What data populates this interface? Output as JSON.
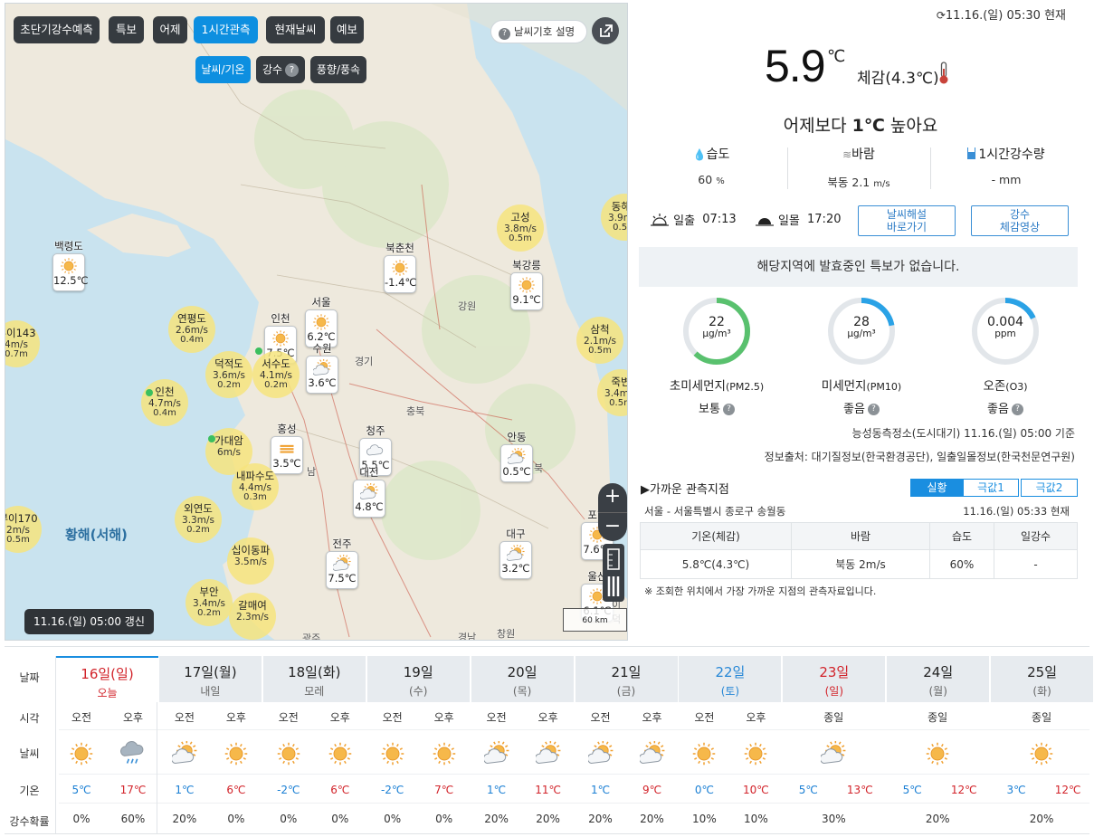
{
  "map": {
    "tabs": [
      "초단기강수예측",
      "특보",
      "어제",
      "1시간관측",
      "현재날씨",
      "예보"
    ],
    "active_tab": "1시간관측",
    "subtabs": [
      "날씨/기온",
      "강수",
      "풍향/풍속"
    ],
    "active_subtab": "날씨/기온",
    "subtab_help": "?",
    "legend_button": "날씨기호 설명",
    "legend_help": "?",
    "sea_label": "황해(서해)",
    "update_label": "11.16.(일) 05:00 갱신",
    "zoom_in": "+",
    "zoom_out": "−",
    "scale_label": "60 km",
    "temp_markers": [
      {
        "name": "백령도",
        "temp": "12.5℃",
        "icon": "sun-icon"
      },
      {
        "name": "북춘천",
        "temp": "-1.4℃",
        "icon": "sun-icon"
      },
      {
        "name": "북강릉",
        "temp": "9.1℃",
        "icon": "sun-icon"
      },
      {
        "name": "인천",
        "temp": "7.5℃",
        "icon": "sun-icon"
      },
      {
        "name": "서울",
        "temp": "6.2℃",
        "icon": "sun-icon"
      },
      {
        "name": "수원",
        "temp": "3.6℃",
        "icon": "cloud-sun-icon"
      },
      {
        "name": "홍성",
        "temp": "3.5℃",
        "icon": "haze-icon"
      },
      {
        "name": "청주",
        "temp": "5.5℃",
        "icon": "cloud-icon"
      },
      {
        "name": "대전",
        "temp": "4.8℃",
        "icon": "cloud-sun-icon"
      },
      {
        "name": "안동",
        "temp": "0.5℃",
        "icon": "cloud-sun-icon"
      },
      {
        "name": "대구",
        "temp": "3.2℃",
        "icon": "cloud-sun-icon"
      },
      {
        "name": "포항",
        "temp": "7.6℃",
        "icon": "sun-icon"
      },
      {
        "name": "전주",
        "temp": "7.5℃",
        "icon": "cloud-sun-icon"
      },
      {
        "name": "울산",
        "temp": "6.1℃",
        "icon": "sun-icon"
      }
    ],
    "wind_markers": [
      {
        "name": "고성",
        "wind": "3.8m/s",
        "wave": "0.5m"
      },
      {
        "name": "동해5",
        "wind": "3.9m/s",
        "wave": "0.5m"
      },
      {
        "name": "연평도",
        "wind": "2.6m/s",
        "wave": "0.4m"
      },
      {
        "name": "삼척",
        "wind": "2.1m/s",
        "wave": "0.5m"
      },
      {
        "name": "덕적도",
        "wind": "3.6m/s",
        "wave": "0.2m"
      },
      {
        "name": "서수도",
        "wind": "4.1m/s",
        "wave": "0.2m"
      },
      {
        "name": "죽변",
        "wind": "3.4m/s",
        "wave": "0.5m"
      },
      {
        "name": "인천",
        "wind": "4.7m/s",
        "wave": "0.4m"
      },
      {
        "name": "부이143",
        "wind": "4m/s",
        "wave": "0.7m"
      },
      {
        "name": "가대암",
        "wind": "6m/s",
        "wave": ""
      },
      {
        "name": "내파수도",
        "wind": "4.4m/s",
        "wave": "0.3m"
      },
      {
        "name": "외연도",
        "wind": "3.3m/s",
        "wave": "0.2m"
      },
      {
        "name": "부이170",
        "wind": "2m/s",
        "wave": "0.5m"
      },
      {
        "name": "십이동파",
        "wind": "3.5m/s",
        "wave": ""
      },
      {
        "name": "부안",
        "wind": "3.4m/s",
        "wave": "0.2m"
      },
      {
        "name": "갈매여",
        "wind": "2.3m/s",
        "wave": ""
      }
    ],
    "cities": [
      "강원",
      "경기",
      "충북",
      "북",
      "남",
      "경북",
      "경남",
      "창원",
      "광주",
      "이덕"
    ]
  },
  "current": {
    "timestamp": "11.16.(일) 05:30 현재",
    "temp_value": "5.9",
    "temp_unit": "℃",
    "feels_like": "체감(4.3℃)",
    "comparison_prefix": "어제보다 ",
    "comparison_value": "1℃",
    "comparison_suffix": " 높아요",
    "humidity_label": "습도",
    "humidity_value": "60",
    "humidity_unit": "%",
    "wind_label": "바람",
    "wind_value": "북동 2.1",
    "wind_unit": "m/s",
    "rain_label": "1시간강수량",
    "rain_value": "- mm",
    "sunrise_label": "일출",
    "sunrise_time": "07:13",
    "sunset_label": "일몰",
    "sunset_time": "17:20",
    "btn_commentary": "날씨해설\n바로가기",
    "btn_video": "강수\n체감영상",
    "alert": "해당지역에 발효중인 특보가 없습니다."
  },
  "air": [
    {
      "name": "초미세먼지",
      "sub": "(PM2.5)",
      "value": "22",
      "unit": "μg/m³",
      "status": "보통",
      "color": "#59c16e",
      "fraction": 0.62
    },
    {
      "name": "미세먼지",
      "sub": "(PM10)",
      "value": "28",
      "unit": "μg/m³",
      "status": "좋음",
      "color": "#2aa2e6",
      "fraction": 0.22
    },
    {
      "name": "오존",
      "sub": "(O3)",
      "value": "0.004",
      "unit": "ppm",
      "status": "좋음",
      "color": "#2aa2e6",
      "fraction": 0.18
    }
  ],
  "station_note": "능성동측정소(도시대기) 11.16.(일) 05:00 기준",
  "source_note": "정보출처: 대기질정보(한국환경공단), 일출일몰정보(한국천문연구원)",
  "nearby": {
    "title": "▶가까운 관측지점",
    "tabs": [
      "실황",
      "극값1",
      "극값2"
    ],
    "active_tab": "실황",
    "location": "서울 - 서울특별시 종로구 송월동",
    "time": "11.16.(일) 05:33 현재",
    "headers": [
      "기온(체감)",
      "바람",
      "습도",
      "일강수"
    ],
    "row": [
      "5.8℃(4.3℃)",
      "북동 2m/s",
      "60%",
      "-"
    ],
    "note": "※ 조회한 위치에서 가장 가까운 지점의 관측자료입니다."
  },
  "forecast": {
    "row_labels": [
      "날짜",
      "시각",
      "날씨",
      "기온",
      "강수확률"
    ],
    "am": "오전",
    "pm": "오후",
    "allday": "종일",
    "days": [
      {
        "date": "16일(일)",
        "word": "오늘",
        "color": "red",
        "split": true,
        "icons": [
          "sun-icon",
          "rain-cloud-icon"
        ],
        "min": "5℃",
        "max": "17℃",
        "pop": [
          "0%",
          "60%"
        ]
      },
      {
        "date": "17일(월)",
        "word": "내일",
        "color": "",
        "split": true,
        "icons": [
          "cloud-sun-icon",
          "sun-icon"
        ],
        "min": "1℃",
        "max": "6℃",
        "pop": [
          "20%",
          "0%"
        ]
      },
      {
        "date": "18일(화)",
        "word": "모레",
        "color": "",
        "split": true,
        "icons": [
          "sun-icon",
          "sun-icon"
        ],
        "min": "-2℃",
        "max": "6℃",
        "pop": [
          "0%",
          "0%"
        ]
      },
      {
        "date": "19일",
        "word": "(수)",
        "color": "",
        "split": true,
        "icons": [
          "sun-icon",
          "sun-icon"
        ],
        "min": "-2℃",
        "max": "7℃",
        "pop": [
          "0%",
          "0%"
        ]
      },
      {
        "date": "20일",
        "word": "(목)",
        "color": "",
        "split": true,
        "icons": [
          "cloud-sun-icon",
          "cloud-sun-icon"
        ],
        "min": "1℃",
        "max": "11℃",
        "pop": [
          "20%",
          "20%"
        ]
      },
      {
        "date": "21일",
        "word": "(금)",
        "color": "",
        "split": true,
        "icons": [
          "cloud-sun-icon",
          "cloud-sun-icon"
        ],
        "min": "1℃",
        "max": "9℃",
        "pop": [
          "20%",
          "20%"
        ]
      },
      {
        "date": "22일",
        "word": "(토)",
        "color": "blue",
        "split": true,
        "icons": [
          "sun-icon",
          "sun-icon"
        ],
        "min": "0℃",
        "max": "10℃",
        "pop": [
          "10%",
          "10%"
        ]
      },
      {
        "date": "23일",
        "word": "(일)",
        "color": "red",
        "split": false,
        "icons": [
          "cloud-sun-icon"
        ],
        "min": "5℃",
        "max": "13℃",
        "pop": [
          "30%"
        ]
      },
      {
        "date": "24일",
        "word": "(월)",
        "color": "",
        "split": false,
        "icons": [
          "sun-icon"
        ],
        "min": "5℃",
        "max": "12℃",
        "pop": [
          "20%"
        ]
      },
      {
        "date": "25일",
        "word": "(화)",
        "color": "",
        "split": false,
        "icons": [
          "sun-icon"
        ],
        "min": "3℃",
        "max": "12℃",
        "pop": [
          "20%"
        ]
      }
    ]
  }
}
